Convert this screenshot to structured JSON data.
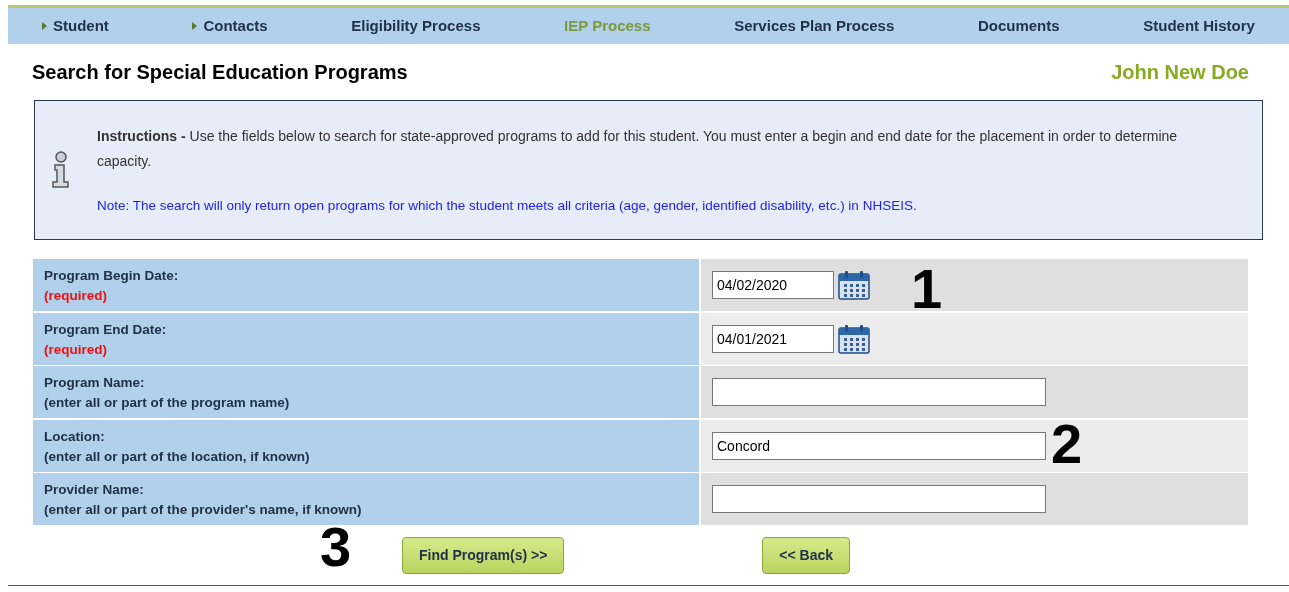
{
  "nav": [
    {
      "label": "Student",
      "selected": false,
      "has_arrow": true
    },
    {
      "label": "Contacts",
      "selected": false,
      "has_arrow": true
    },
    {
      "label": "Eligibility Process",
      "selected": false,
      "has_arrow": false
    },
    {
      "label": "IEP Process",
      "selected": true,
      "has_arrow": false
    },
    {
      "label": "Services Plan Process",
      "selected": false,
      "has_arrow": false
    },
    {
      "label": "Documents",
      "selected": false,
      "has_arrow": false
    },
    {
      "label": "Student History",
      "selected": false,
      "has_arrow": false
    }
  ],
  "page_title": "Search for Special Education Programs",
  "student_name": "John New Doe",
  "instructions": {
    "text": "**Instructions -** Use the fields below to search for state-approved programs to add for this student. You must enter a begin and end date for the placement in order to determine capacity.",
    "note": "Note: The search will only return open programs for which the student meets all criteria (age, gender, identified disability, etc.) in NHSEIS."
  },
  "form_rows": [
    {
      "kind": "date",
      "label": "Program Begin Date:",
      "hint": "(required)",
      "required": true,
      "value": "04/02/2020",
      "annotation": "1"
    },
    {
      "kind": "date",
      "label": "Program End Date:",
      "hint": "(required)",
      "required": true,
      "value": "04/01/2021"
    },
    {
      "kind": "text",
      "label": "Program Name:",
      "hint": "(enter all or part of the program name)",
      "required": false
    },
    {
      "kind": "text",
      "label": "Location:",
      "hint": "(enter all or part of the location, if known)",
      "required": false,
      "value": "Concord",
      "annotation": "2"
    },
    {
      "kind": "text",
      "label": "Provider Name:",
      "hint": "(enter all or part of the provider's name, if known)",
      "required": false
    }
  ],
  "actions": {
    "annotation": "3",
    "buttons": [
      "Find Program(s) >>",
      "<< Back"
    ]
  }
}
